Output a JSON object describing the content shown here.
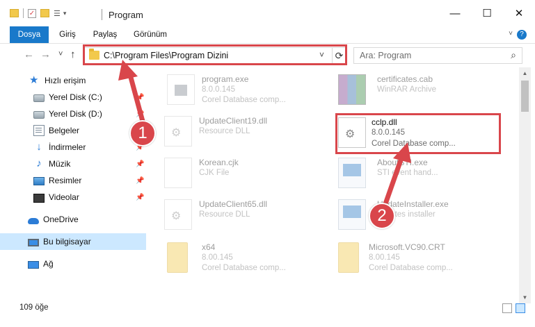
{
  "window": {
    "title": "Program",
    "minimize_label": "—",
    "maximize_label": "☐",
    "close_label": "✕"
  },
  "ribbon": {
    "tabs": [
      {
        "label": "Dosya"
      },
      {
        "label": "Giriş"
      },
      {
        "label": "Paylaş"
      },
      {
        "label": "Görünüm"
      }
    ],
    "help_label": "?"
  },
  "nav": {
    "back_label": "←",
    "forward_label": "→",
    "recent_label": "˅",
    "up_label": "↑",
    "address": "C:\\Program Files\\Program Dizini",
    "address_dropdown": "˅",
    "refresh_label": "⟳",
    "search_placeholder": "Ara: Program",
    "search_icon": "⌕"
  },
  "sidebar": {
    "items": [
      {
        "label": "Hızlı erişim",
        "icon": "star-icon",
        "pinned": false
      },
      {
        "label": "Yerel Disk (C:)",
        "icon": "disk-icon",
        "pinned": true
      },
      {
        "label": "Yerel Disk (D:)",
        "icon": "disk-icon",
        "pinned": true
      },
      {
        "label": "Belgeler",
        "icon": "document-icon",
        "pinned": true
      },
      {
        "label": "İndirmeler",
        "icon": "download-icon",
        "pinned": true
      },
      {
        "label": "Müzik",
        "icon": "music-icon",
        "pinned": true
      },
      {
        "label": "Resimler",
        "icon": "pictures-icon",
        "pinned": true
      },
      {
        "label": "Videolar",
        "icon": "videos-icon",
        "pinned": true
      },
      {
        "label": "OneDrive",
        "icon": "cloud-icon",
        "pinned": false
      },
      {
        "label": "Bu bilgisayar",
        "icon": "computer-icon",
        "pinned": false
      },
      {
        "label": "Ağ",
        "icon": "network-icon",
        "pinned": false
      }
    ],
    "pin_glyph": "📌",
    "selected": "Bu bilgisayar"
  },
  "files": {
    "left": [
      {
        "name": "program.exe",
        "line1": "8.0.0.145",
        "line2": "Corel Database comp...",
        "icon": "exe-file-icon"
      },
      {
        "name": "UpdateClient19.dll",
        "line1": "Resource DLL",
        "line2": "",
        "icon": "dll-file-icon"
      },
      {
        "name": "Korean.cjk",
        "line1": "CJK File",
        "line2": "",
        "icon": "generic-file-icon"
      },
      {
        "name": "UpdateClient65.dll",
        "line1": "Resource DLL",
        "line2": "",
        "icon": "dll-file-icon"
      },
      {
        "name": "x64",
        "line1": "8.00.145",
        "line2": "Corel Database comp...",
        "icon": "folder-icon"
      }
    ],
    "right": [
      {
        "name": "certificates.cab",
        "line1": "WinRAR Archive",
        "line2": "",
        "icon": "archive-file-icon"
      },
      {
        "name": "cclp.dll",
        "line1": "8.0.0.145",
        "line2": "Corel Database comp...",
        "icon": "dll-file-icon"
      },
      {
        "name": "AboutSTI.exe",
        "line1": "STI event hand...",
        "line2": "",
        "icon": "window-exe-icon"
      },
      {
        "name": "UpdateInstaller.exe",
        "line1": "updates installer",
        "line2": "",
        "icon": "window-exe-icon"
      },
      {
        "name": "Microsoft.VC90.CRT",
        "line1": "8.00.145",
        "line2": "Corel Database comp...",
        "icon": "folder-icon"
      }
    ]
  },
  "callouts": {
    "one": "1",
    "two": "2"
  },
  "status": {
    "count": "109 öğe"
  },
  "colors": {
    "accent": "#1979ca",
    "highlight": "#d9464b",
    "selection": "#cce8ff"
  }
}
